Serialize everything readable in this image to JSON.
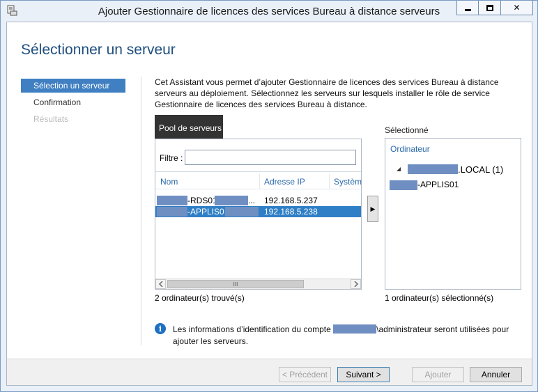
{
  "window": {
    "title": "Ajouter Gestionnaire de licences des services Bureau à distance serveurs",
    "minimize_icon": "minimize-icon",
    "maximize_icon": "maximize-icon",
    "close_label": "✕"
  },
  "page": {
    "title": "Sélectionner un serveur",
    "intro": "Cet Assistant vous permet d’ajouter Gestionnaire de licences des services Bureau à distance serveurs au déploiement. Sélectionnez les serveurs sur lesquels installer le rôle de service Gestionnaire de licences des services Bureau à distance."
  },
  "nav": {
    "items": [
      {
        "label": "Sélection un serveur",
        "state": "active"
      },
      {
        "label": "Confirmation",
        "state": "normal"
      },
      {
        "label": "Résultats",
        "state": "disabled"
      }
    ]
  },
  "pool": {
    "tab_label": "Pool de serveurs",
    "filter_label": "Filtre :",
    "filter_value": "",
    "columns": {
      "name": "Nom",
      "ip": "Adresse IP",
      "os": "Systèm"
    },
    "rows": [
      {
        "name": "-RDS01",
        "name_suffix": "...",
        "ip": "192.168.5.237",
        "selected": false
      },
      {
        "name": "-APPLIS01.",
        "name_suffix": "",
        "ip": "192.168.5.238",
        "selected": true
      }
    ],
    "scroll_thumb": "III",
    "found_text": "2 ordinateur(s) trouvé(s)"
  },
  "move_button": "▶",
  "selected": {
    "label": "Sélectionné",
    "header": "Ordinateur",
    "domain_node": ".LOCAL (1)",
    "server_node": "-APPLIS01",
    "count_text": "1 ordinateur(s) sélectionné(s)"
  },
  "info": {
    "text_before": "Les informations d’identification du compte",
    "text_after": "\\administrateur seront utilisées pour ajouter les serveurs."
  },
  "footer": {
    "previous": "< Précédent",
    "next": "Suivant >",
    "add": "Ajouter",
    "cancel": "Annuler"
  },
  "colors": {
    "accent": "#3f7fc2",
    "title": "#1f4f7f",
    "redaction": "#6f8fc2"
  }
}
